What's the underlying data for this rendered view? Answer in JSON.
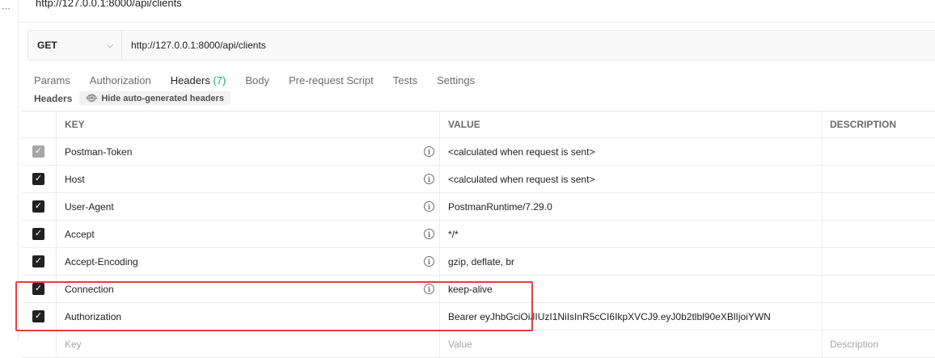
{
  "request": {
    "title": "http://127.0.0.1:8000/api/clients",
    "method": "GET",
    "url": "http://127.0.0.1:8000/api/clients"
  },
  "tabs": [
    {
      "label": "Params"
    },
    {
      "label": "Authorization"
    },
    {
      "label": "Headers",
      "count": "(7)"
    },
    {
      "label": "Body"
    },
    {
      "label": "Pre-request Script"
    },
    {
      "label": "Tests"
    },
    {
      "label": "Settings"
    }
  ],
  "headers_section": {
    "label": "Headers",
    "hide_button": "Hide auto-generated headers"
  },
  "table": {
    "columns": {
      "key": "KEY",
      "value": "VALUE",
      "description": "DESCRIPTION"
    },
    "rows": [
      {
        "key": "Postman-Token",
        "value": "<calculated when request is sent>"
      },
      {
        "key": "Host",
        "value": "<calculated when request is sent>"
      },
      {
        "key": "User-Agent",
        "value": "PostmanRuntime/7.29.0"
      },
      {
        "key": "Accept",
        "value": "*/*"
      },
      {
        "key": "Accept-Encoding",
        "value": "gzip, deflate, br"
      },
      {
        "key": "Connection",
        "value": "keep-alive"
      },
      {
        "key": "Authorization",
        "value": "Bearer eyJhbGciOiJIUzI1NiIsInR5cCI6IkpXVCJ9.eyJ0b2tlbl90eXBlIjoiYWN"
      }
    ],
    "placeholder": {
      "key": "Key",
      "value": "Value",
      "description": "Description"
    }
  },
  "colors": {
    "accent": "#ff6c37",
    "count": "#0cbb52",
    "highlight": "#e0413f"
  }
}
